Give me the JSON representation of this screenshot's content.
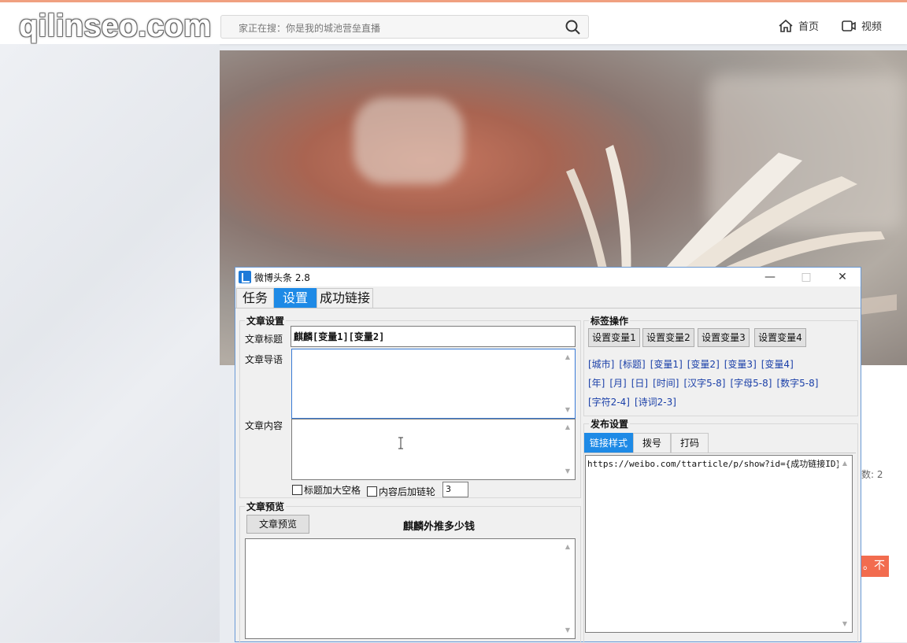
{
  "browser": {
    "watermark": "qilinseo.com",
    "search_placeholder": "家正在搜：你是我的城池营垒直播",
    "nav": {
      "home_label": "首页",
      "video_label": "视频"
    },
    "side_snippet": "数: 2",
    "side_orange_text": "。不"
  },
  "app": {
    "title": "微博头条 2.8",
    "window_buttons": {
      "minimize": "—",
      "maximize": "□",
      "close": "✕"
    },
    "tabs": [
      "任务",
      "设置",
      "成功链接"
    ],
    "article_settings": {
      "group_label": "文章设置",
      "title_label": "文章标题",
      "title_value": "麒麟[变量1][变量2]",
      "lead_label": "文章导语",
      "content_label": "文章内容",
      "opt_title_space": "标题加大空格",
      "opt_content_link": "内容后加链轮",
      "link_count": "3"
    },
    "preview": {
      "group_label": "文章预览",
      "button": "文章预览",
      "preview_title": "麒麟外推多少钱"
    },
    "tag_ops": {
      "group_label": "标签操作",
      "buttons": [
        "设置变量1",
        "设置变量2",
        "设置变量3",
        "设置变量4"
      ],
      "tags_row1": [
        "[城市]",
        "[标题]",
        "[变量1]",
        "[变量2]",
        "[变量3]",
        "[变量4]"
      ],
      "tags_row2": [
        "[年]",
        "[月]",
        "[日]",
        "[时间]",
        "[汉字5-8]",
        "[字母5-8]",
        "[数字5-8]"
      ],
      "tags_row3": [
        "[字符2-4]",
        "[诗词2-3]"
      ]
    },
    "publish": {
      "group_label": "发布设置",
      "tabs": [
        "链接样式",
        "拨号",
        "打码"
      ],
      "link_template": "https://weibo.com/ttarticle/p/show?id={成功链接ID}"
    }
  }
}
